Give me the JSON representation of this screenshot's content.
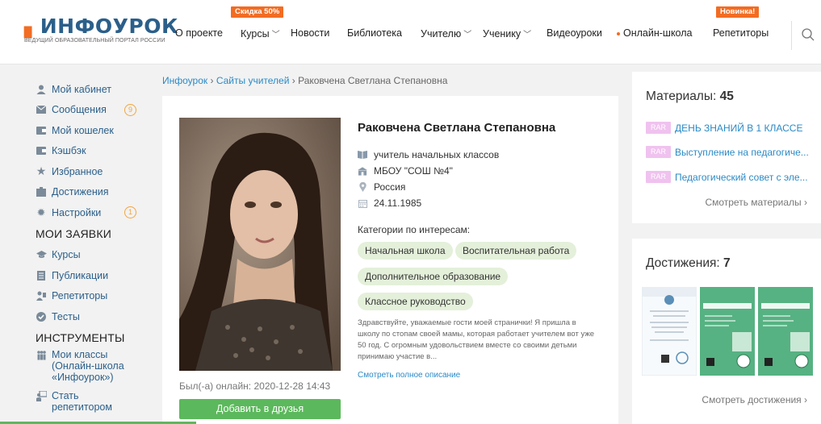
{
  "header": {
    "logo_text": "ИНФОУРОК",
    "logo_sub": "ВЕДУЩИЙ ОБРАЗОВАТЕЛЬНЫЙ ПОРТАЛ РОССИИ",
    "nav": [
      "О проекте",
      "Курсы",
      "Новости",
      "Библиотека",
      "Учителю",
      "Ученику",
      "Видеоуроки",
      "Онлайн-школа",
      "Репетиторы"
    ],
    "discount_badge": "Скидка 50%",
    "new_badge": "Новинка!",
    "accent_color": "#f26c22",
    "brand_color": "#2b5f8a"
  },
  "sidebar": {
    "items": [
      {
        "label": "Мой кабинет",
        "icon": "user-icon"
      },
      {
        "label": "Сообщения",
        "icon": "mail-icon",
        "count": "9"
      },
      {
        "label": "Мой кошелек",
        "icon": "wallet-icon"
      },
      {
        "label": "Кэшбэк",
        "icon": "cashback-icon"
      },
      {
        "label": "Избранное",
        "icon": "star-icon"
      },
      {
        "label": "Достижения",
        "icon": "trophy-icon"
      },
      {
        "label": "Настройки",
        "icon": "gear-icon",
        "count": "1"
      }
    ],
    "requests_heading": "МОИ ЗАЯВКИ",
    "requests": [
      {
        "label": "Курсы",
        "icon": "graduation-icon"
      },
      {
        "label": "Публикации",
        "icon": "document-icon"
      },
      {
        "label": "Репетиторы",
        "icon": "tutor-icon"
      },
      {
        "label": "Тесты",
        "icon": "check-icon"
      }
    ],
    "tools_heading": "ИНСТРУМЕНТЫ",
    "tools": [
      {
        "label": "Мои классы (Онлайн-школа «Инфоурок»)",
        "line1": "Мои классы",
        "line2": "(Онлайн-школа",
        "line3": "«Инфоурок»)",
        "icon": "class-icon"
      },
      {
        "label": "Стать репетитором",
        "line1": "Стать",
        "line2": "репетитором",
        "icon": "become-tutor-icon"
      }
    ]
  },
  "breadcrumb": {
    "home": "Инфоурок",
    "sep": " › ",
    "section": "Сайты учителей",
    "current": "Раковчена Светлана Степановна"
  },
  "profile": {
    "name": "Раковчена Светлана Степановна",
    "position": "учитель начальных классов",
    "school": "МБОУ \"СОШ №4\"",
    "country": "Россия",
    "birthdate": "24.11.1985",
    "categories_title": "Категории по интересам:",
    "tags": [
      "Начальная школа",
      "Воспитательная работа",
      "Дополнительное образование",
      "Классное руководство"
    ],
    "about": "Здравствуйте, уважаемые гости моей странички! Я пришла в школу по стопам своей мамы, которая работает учителем вот уже 50 год. С огромным удовольствием вместе со своими детьми принимаю участие в...",
    "more_link": "Смотреть полное описание",
    "last_online": "Был(-а) онлайн: 2020-12-28 14:43",
    "add_friend": "Добавить в друзья"
  },
  "materials": {
    "title": "Материалы:",
    "count": "45",
    "items": [
      {
        "badge": "RAR",
        "title": "ДЕНЬ ЗНАНИЙ В 1 КЛАССЕ"
      },
      {
        "badge": "RAR",
        "title": "Выступление на педагогиче..."
      },
      {
        "badge": "RAR",
        "title": "Педагогический совет с эле..."
      }
    ],
    "more": "Смотреть материалы ›"
  },
  "achievements": {
    "title": "Достижения:",
    "count": "7",
    "cert_labels": [
      "СВИДЕТЕЛЬСТВО",
      "СВИДЕТЕЛЬСТВО"
    ],
    "more": "Смотреть достижения ›"
  }
}
